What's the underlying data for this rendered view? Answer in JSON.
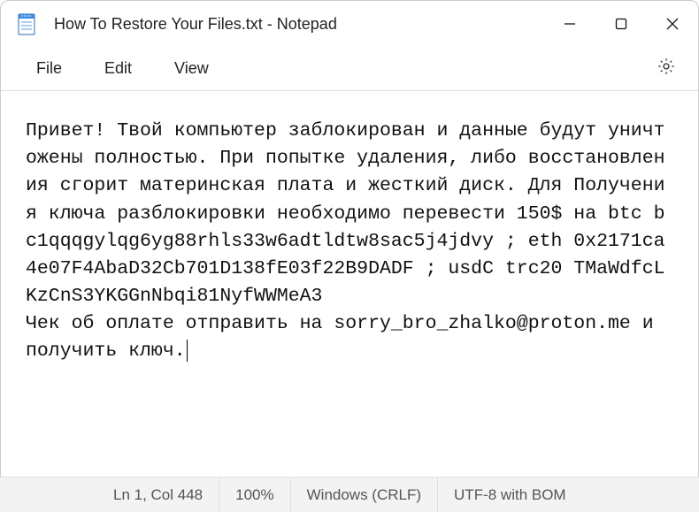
{
  "window": {
    "title": "How To Restore Your Files.txt - Notepad"
  },
  "menu": {
    "file": "File",
    "edit": "Edit",
    "view": "View"
  },
  "content": {
    "text": "Привет! Твой компьютер заблокирован и данные будут уничтожены полностью. При попытке удаления, либо восстановления сгорит материнская плата и жесткий диск. Для Получения ключа разблокировки необходимо перевести 150$ на btc bc1qqqgylqg6yg88rhls33w6adtldtw8sac5j4jdvy ; eth 0x2171ca4e07F4AbaD32Cb701D138fE03f22B9DADF ; usdC trc20 TMaWdfcLKzCnS3YKGGnNbqi81NyfWWMeA3\nЧек об оплате отправить на sorry_bro_zhalko@proton.me и получить ключ."
  },
  "statusbar": {
    "position": "Ln 1, Col 448",
    "zoom": "100%",
    "lineending": "Windows (CRLF)",
    "encoding": "UTF-8 with BOM"
  }
}
